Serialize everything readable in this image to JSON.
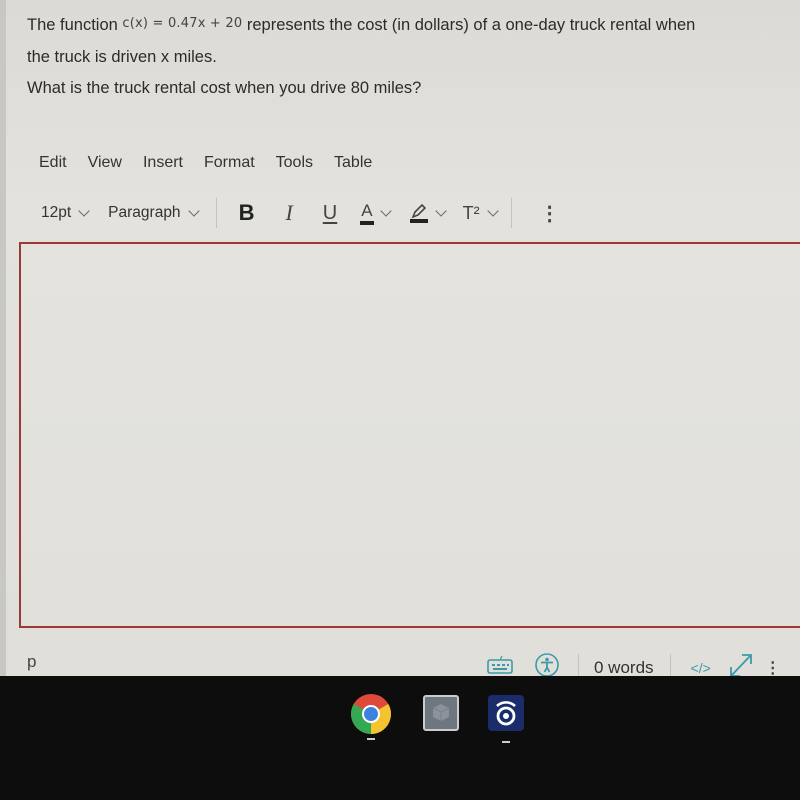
{
  "question": {
    "line1_prefix": "The function",
    "formula": "c(x) = 0.47x + 20",
    "line1_suffix": "represents the cost (in dollars) of a one-day truck rental when",
    "line2_prefix": "the truck is driven ",
    "line2_var": "x",
    "line2_suffix": " miles.",
    "line3": "What is the truck rental cost when you drive 80 miles?"
  },
  "menubar": {
    "items": [
      "Edit",
      "View",
      "Insert",
      "Format",
      "Tools",
      "Table"
    ]
  },
  "toolbar": {
    "font_size": "12pt",
    "block_format": "Paragraph",
    "bold": "B",
    "italic": "I",
    "underline": "U",
    "text_color": "A",
    "superscript": "T²",
    "more": "⋮"
  },
  "editor": {
    "content": ""
  },
  "statusbar": {
    "path": "p",
    "word_count": "0 words",
    "html_editor": "</>",
    "colors": {
      "accent": "#3b9aa8",
      "editor_border": "#9a3a38"
    }
  },
  "taskbar": {
    "apps": [
      "Chrome",
      "Files box",
      "Radio app"
    ]
  }
}
